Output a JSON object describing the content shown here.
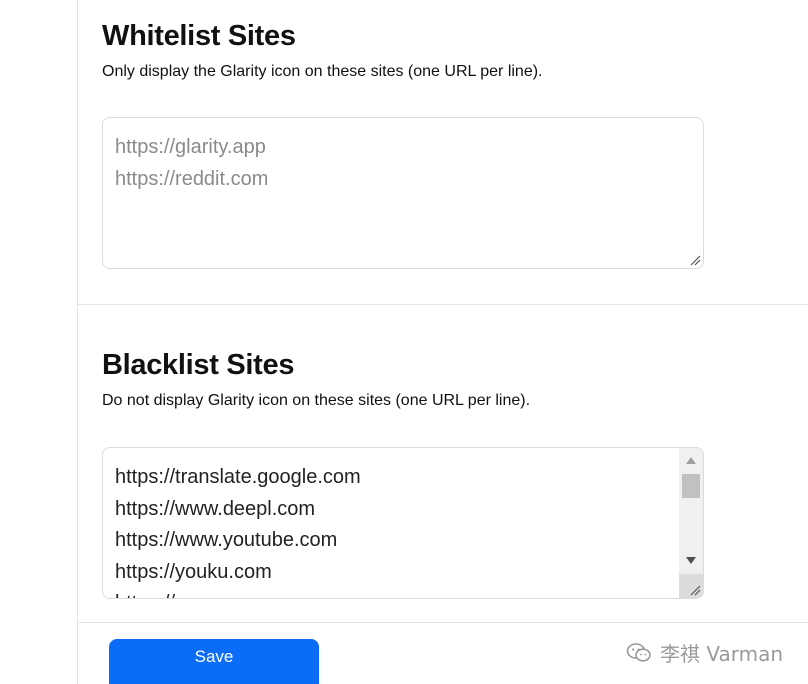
{
  "whitelist": {
    "title": "Whitelist Sites",
    "description": "Only display the Glarity icon on these sites (one URL per line).",
    "placeholder_lines": [
      "https://glarity.app",
      "https://reddit.com"
    ]
  },
  "blacklist": {
    "title": "Blacklist Sites",
    "description": "Do not display Glarity icon on these sites (one URL per line).",
    "lines": [
      "https://translate.google.com",
      "https://www.deepl.com",
      "https://www.youtube.com",
      "https://youku.com",
      "https://..."
    ]
  },
  "actions": {
    "save_label": "Save"
  },
  "watermark": {
    "text": "李祺 Varman",
    "icon": "wechat-logo-icon"
  },
  "colors": {
    "primary": "#0a6cf7",
    "border": "#dcdcdc",
    "placeholder": "#8a8a8a"
  }
}
